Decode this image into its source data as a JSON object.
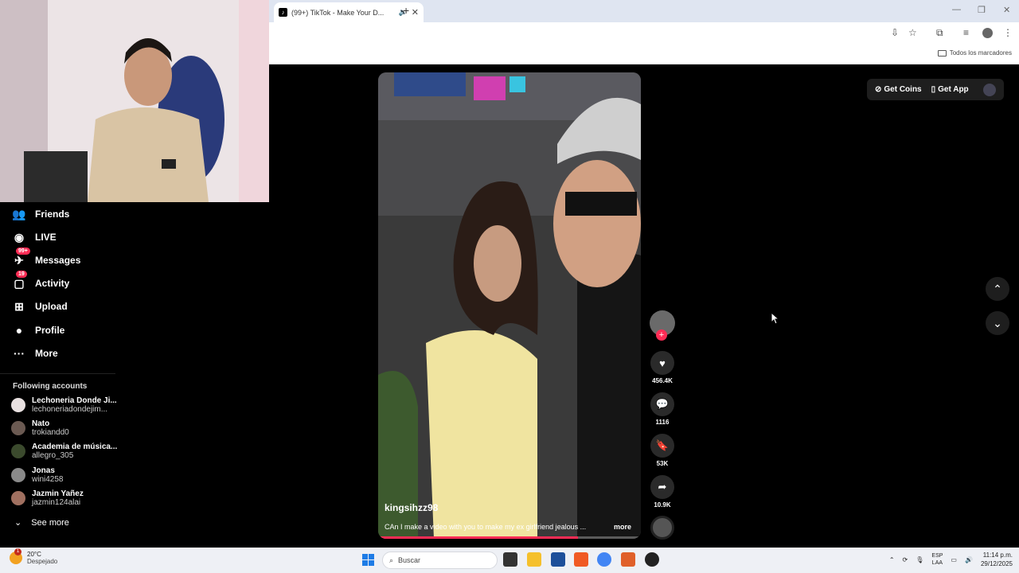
{
  "browser": {
    "tab_title": "(99+) TikTok - Make Your D...",
    "new_tab": "+",
    "minimize": "—",
    "maximize": "❐",
    "close": "✕",
    "bookmarks_label": "Todos los marcadores"
  },
  "sidebar": {
    "items": [
      {
        "label": "Friends",
        "icon": "friends-icon",
        "glyph": "👥"
      },
      {
        "label": "LIVE",
        "icon": "live-icon",
        "glyph": "◉"
      },
      {
        "label": "Messages",
        "icon": "messages-icon",
        "glyph": "✈",
        "badge": "99+"
      },
      {
        "label": "Activity",
        "icon": "activity-icon",
        "glyph": "▢",
        "badge": "19"
      },
      {
        "label": "Upload",
        "icon": "upload-icon",
        "glyph": "⊞"
      },
      {
        "label": "Profile",
        "icon": "profile-icon",
        "glyph": "●"
      },
      {
        "label": "More",
        "icon": "more-icon",
        "glyph": "···"
      }
    ],
    "following_title": "Following accounts",
    "accounts": [
      {
        "name": "Lechoneria Donde Ji...",
        "user": "lechoneriadondejim..."
      },
      {
        "name": "Nato",
        "user": "trokiandd0"
      },
      {
        "name": "Academia de música...",
        "user": "allegro_305"
      },
      {
        "name": "Jonas",
        "user": "wini4258"
      },
      {
        "name": "Jazmin Yañez",
        "user": "jazmin124alai"
      }
    ],
    "see_more": "See more"
  },
  "video": {
    "author": "kingsihzz98",
    "caption": "CAn I make a video with you to make my ex girlfriend jealous ...",
    "more": "more",
    "progress": 0.76
  },
  "actions": {
    "likes": "456.4K",
    "comments": "1116",
    "saves": "53K",
    "shares": "10.9K"
  },
  "topbar": {
    "get_coins": "Get Coins",
    "get_app": "Get App"
  },
  "taskbar": {
    "temp": "20°C",
    "weather_desc": "Despejado",
    "weather_alert": "1",
    "search_placeholder": "Buscar",
    "lang_1": "ESP",
    "lang_2": "LAA",
    "time": "11:14 p.m.",
    "date": "29/12/2025"
  },
  "colors": {
    "accent": "#fe2c55",
    "windows_blue": "#1e7ce6"
  }
}
